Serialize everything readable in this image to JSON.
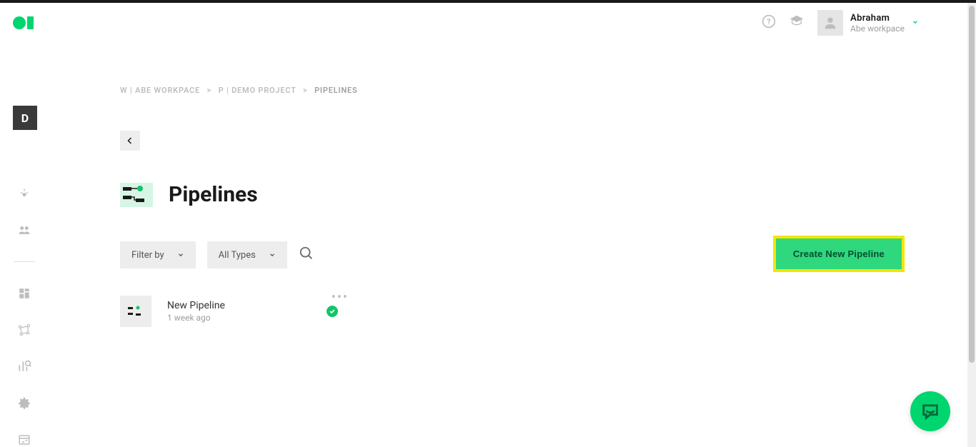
{
  "header": {
    "user_name": "Abraham",
    "workspace_name": "Abe workpace"
  },
  "sidebar": {
    "project_letter": "D"
  },
  "breadcrumb": {
    "crumb1": "W | ABE WORKPACE",
    "sep": ">",
    "crumb2": "P | DEMO PROJECT",
    "crumb3": "PIPELINES"
  },
  "page": {
    "title": "Pipelines",
    "filter_label": "Filter by",
    "types_label": "All Types",
    "create_button": "Create New Pipeline"
  },
  "pipelines": [
    {
      "name": "New Pipeline",
      "time": "1 week ago"
    }
  ]
}
